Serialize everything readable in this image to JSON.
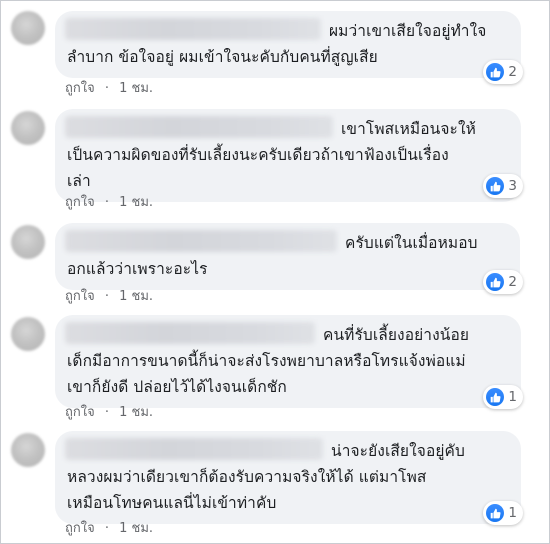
{
  "comments": [
    {
      "lines": [
        "ผมว่าเขาเสียใจอยู่ทำใจ",
        "ลำบาก ข้อใจอยู่ ผมเข้าใจนะคับกับคนที่สูญเสีย"
      ],
      "like_label": "ถูกใจ",
      "time": "1 ชม.",
      "reaction_icon": "like-icon",
      "reaction_count": "2"
    },
    {
      "lines": [
        "เขาโพสเหมือนจะให้",
        "เป็นความผิดของที่รับเลี้ยงนะครับเดียวถ้าเขาฟ้องเป็นเรื่อง",
        "เล่า"
      ],
      "like_label": "ถูกใจ",
      "time": "1 ชม.",
      "reaction_icon": "like-icon",
      "reaction_count": "3"
    },
    {
      "lines": [
        "ครับแต่ในเมื่อหมอบ",
        "อกแล้วว่าเพราะอะไร"
      ],
      "like_label": "ถูกใจ",
      "time": "1 ชม.",
      "reaction_icon": "like-icon",
      "reaction_count": "2"
    },
    {
      "lines": [
        "คนที่รับเลี้ยงอย่างน้อย",
        "เด็กมีอาการขนาดนี้ก็น่าจะส่งโรงพยาบาลหรือโทรแจ้งพ่อแม่",
        "เขาก็ยังดี ปล่อยไว้ได้ไงจนเด็กชัก"
      ],
      "like_label": "ถูกใจ",
      "time": "1 ชม.",
      "reaction_icon": "like-icon",
      "reaction_count": "1"
    },
    {
      "lines": [
        "น่าจะยังเสียใจอยู่คับ",
        "หลวงผมว่าเดียวเขาก็ต้องรับความจริงให้ได้ แต่มาโพส",
        "เหมือนโทษคนแลนี่ไม่เข้าท่าคับ"
      ],
      "like_label": "ถูกใจ",
      "time": "1 ชม.",
      "reaction_icon": "like-icon",
      "reaction_count": "1"
    }
  ],
  "colors": {
    "bubble": "#f0f2f5",
    "text": "#1c1e21",
    "meta": "#65676b",
    "like_blue": "#1877f2"
  }
}
